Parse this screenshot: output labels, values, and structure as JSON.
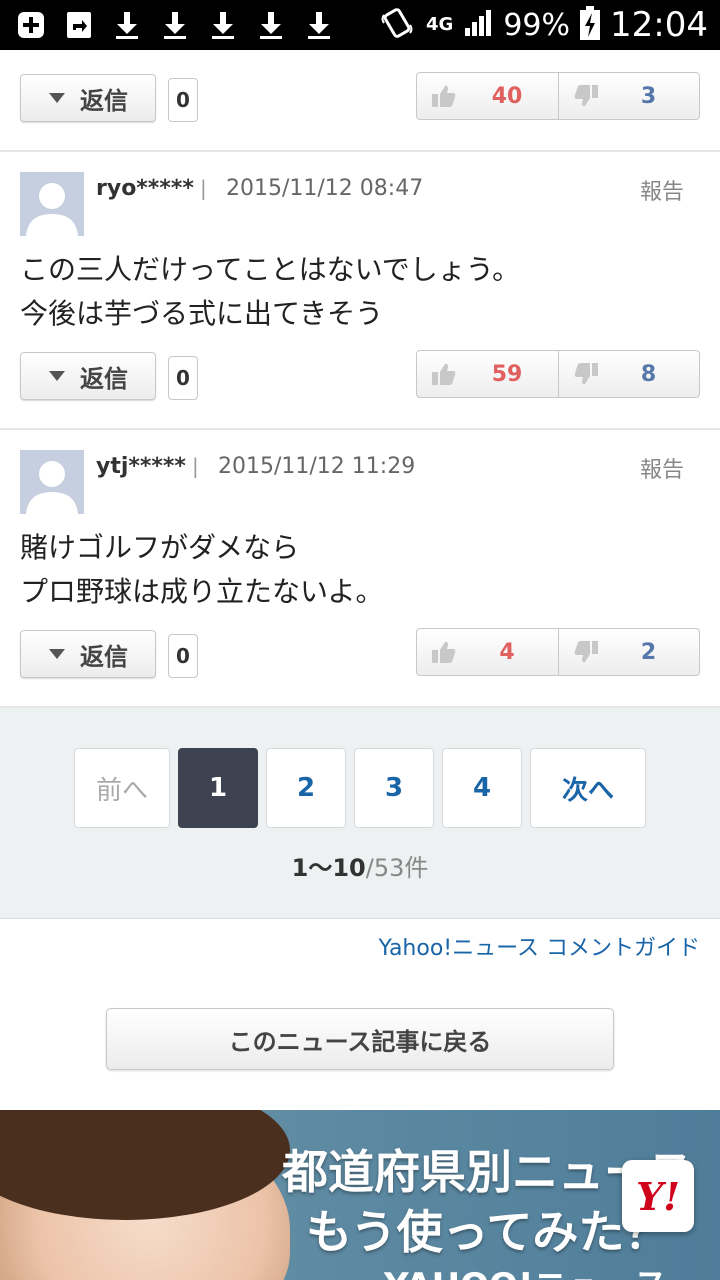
{
  "statusbar": {
    "battery": "99%",
    "time": "12:04",
    "network": "4G"
  },
  "comments": [
    {
      "user": "",
      "date": "",
      "report": "",
      "text": [],
      "reply_label": "返信",
      "reply_count": "0",
      "good": "40",
      "bad": "3"
    },
    {
      "user": "ryo*****",
      "separator": "|",
      "date": "2015/11/12 08:47",
      "report": "報告",
      "text": [
        "この三人だけってことはないでしょう。",
        "今後は芋づる式に出てきそう"
      ],
      "reply_label": "返信",
      "reply_count": "0",
      "good": "59",
      "bad": "8"
    },
    {
      "user": "ytj*****",
      "separator": "|",
      "date": "2015/11/12 11:29",
      "report": "報告",
      "text": [
        "賭けゴルフがダメなら",
        "プロ野球は成り立たないよ。"
      ],
      "reply_label": "返信",
      "reply_count": "0",
      "good": "4",
      "bad": "2"
    }
  ],
  "pager": {
    "prev": "前へ",
    "pages": [
      "1",
      "2",
      "3",
      "4"
    ],
    "current": "1",
    "next": "次へ",
    "range": "1〜10",
    "total": "/53件"
  },
  "guide_link": "Yahoo!ニュース コメントガイド",
  "back_button": "このニュース記事に戻る",
  "banner": {
    "line1": "都道府県別ニュース",
    "line2": "もう使ってみた？",
    "brand": "YAHOO!ニュース",
    "icon_text": "Y!"
  },
  "colors": {
    "good": "#e06060",
    "bad": "#5577aa",
    "link": "#1a65a8",
    "current_page": "#3d4250"
  }
}
